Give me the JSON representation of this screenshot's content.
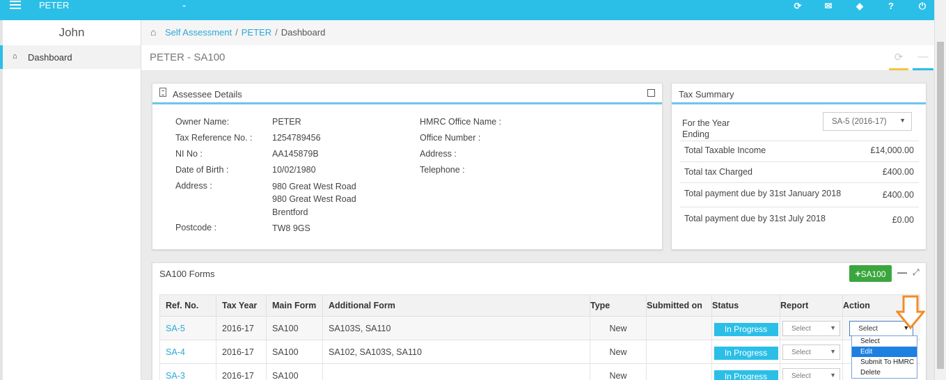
{
  "topbar": {
    "client": "PETER"
  },
  "sidebar": {
    "user": "John",
    "items": [
      {
        "label": "Dashboard"
      }
    ]
  },
  "breadcrumb": {
    "items": [
      "Self Assessment",
      "PETER"
    ],
    "current": "Dashboard"
  },
  "page": {
    "title": "PETER - SA100"
  },
  "assessee": {
    "title": "Assessee Details",
    "left": [
      {
        "label": "Owner Name:",
        "value": "PETER"
      },
      {
        "label": "Tax Reference No. :",
        "value": "1254789456"
      },
      {
        "label": "NI No :",
        "value": "AA145879B"
      },
      {
        "label": "Date of Birth :",
        "value": "10/02/1980"
      },
      {
        "label": "Address :",
        "value": "980 Great West Road"
      },
      {
        "label": "",
        "value": "980 Great West Road"
      },
      {
        "label": "",
        "value": "Brentford"
      },
      {
        "label": "Postcode :",
        "value": "TW8 9GS"
      }
    ],
    "right": [
      "HMRC Office Name :",
      "Office Number :",
      "Address :",
      "Telephone :"
    ]
  },
  "tax": {
    "title": "Tax Summary",
    "year_label_1": "For the Year",
    "year_label_2": "Ending",
    "year_select": "SA-5 (2016-17)",
    "rows": [
      {
        "label": "Total Taxable Income",
        "value": "£14,000.00"
      },
      {
        "label": "Total tax Charged",
        "value": "£400.00"
      },
      {
        "label": "Total payment due by 31st January 2018",
        "value": "£400.00"
      },
      {
        "label": "Total payment due by 31st July 2018",
        "value": "£0.00"
      }
    ]
  },
  "forms": {
    "title": "SA100 Forms",
    "add_label": "SA100",
    "headers": [
      "Ref. No.",
      "Tax Year",
      "Main Form",
      "Additional Form",
      "Type",
      "Submitted on",
      "Status",
      "Report",
      "Action"
    ],
    "rows": [
      {
        "ref": "SA-5",
        "year": "2016-17",
        "main": "SA100",
        "additional": "SA103S, SA110",
        "type": "New",
        "submitted": "",
        "status": "In Progress",
        "report": "Select",
        "action": "Select"
      },
      {
        "ref": "SA-4",
        "year": "2016-17",
        "main": "SA100",
        "additional": "SA102, SA103S, SA110",
        "type": "New",
        "submitted": "",
        "status": "In Progress",
        "report": "Select",
        "action": "Select"
      },
      {
        "ref": "SA-3",
        "year": "2016-17",
        "main": "SA100",
        "additional": "",
        "type": "New",
        "submitted": "",
        "status": "In Progress",
        "report": "Select",
        "action": "Select"
      }
    ],
    "action_options": [
      "Select",
      "Edit",
      "Submit To HMRC",
      "Delete"
    ],
    "highlighted_option": "Edit"
  },
  "colors": {
    "accent": "#2bbfe8",
    "add_button": "#3aa63e",
    "annotation": "#f28c28"
  }
}
